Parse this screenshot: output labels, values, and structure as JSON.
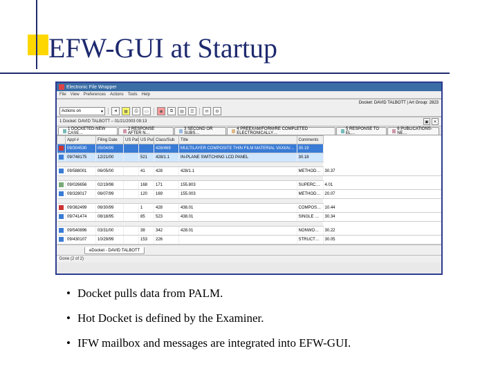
{
  "slide": {
    "title": "EFW-GUI at Startup"
  },
  "app": {
    "window_title": "Electronic File Wrapper",
    "menubar": [
      "File",
      "View",
      "Preferences",
      "Actions",
      "Tools",
      "Help"
    ],
    "status_right": "Docket: DAVID TALBOTT | Art Group: 2823",
    "toolbar": {
      "select_label": "Actions on"
    },
    "panel_title": "1 Docket: DAVID TALBOTT – 01/21/2003 09:13",
    "tabs": [
      "1 DOCKETED-NEW CASE…",
      "2 RESPONSE AFTER N…",
      "3 SECOND OR SUBS…",
      "4 PREEXAM/FORM/RE COMPLETED ELECTRONICALLY…",
      "5 RESPONSE TO EL…",
      "6 PUBLICATIONS-NE…"
    ],
    "columns": [
      "",
      "Appl #",
      "Filing Date",
      "US Pat",
      "US Pub",
      "Class/Sub",
      "Title",
      "Comments"
    ],
    "rows": [
      {
        "ico": "flag",
        "sel": true,
        "c": [
          "09/304530",
          "05/04/99",
          "",
          "",
          "428/469",
          "MULTILAYER COMPOSITE THIN FILM MATERIAL VAXI/A/AE/BIONEN…",
          "30.19"
        ]
      },
      {
        "ico": "person",
        "hl": true,
        "c": [
          "09/748175",
          "12/21/00",
          "",
          "521",
          "428/1.1",
          "IN-PLANE SWITCHING LCD PANEL",
          "30.18"
        ]
      },
      {
        "spacer": true
      },
      {
        "ico": "person",
        "c": [
          "09/588001",
          "06/05/00",
          "",
          "41",
          "428",
          "428/1.1",
          "METHOD OF CONTINUOUS PROGRAM CIRCUIT AND MANUFACTURING CO…",
          "30.37"
        ]
      },
      {
        "spacer": true
      },
      {
        "ico": "doc",
        "c": [
          "09/026656",
          "02/19/98",
          "",
          "168",
          "171",
          "155.803",
          "SUPERCONDUCTING WIRE AND MANUFACTURING METHOD FOR THE SAME",
          "4.01"
        ]
      },
      {
        "ico": "person",
        "c": [
          "09/328017",
          "06/07/99",
          "",
          "120",
          "169",
          "155.003",
          "METHODS OF MAKING COMPLIANT SEMICONDUCTOR CHIP PACKAGES",
          "20.07"
        ]
      },
      {
        "spacer": true
      },
      {
        "ico": "flag",
        "c": [
          "09/362499",
          "06/30/99",
          "",
          "1",
          "428",
          "438.01",
          "COMPOSITE LAMINATED PANEL HAVING A UNIVERSAL SUBSTRATE WITH VARIOUS M…",
          "10.44"
        ]
      },
      {
        "ico": "person",
        "c": [
          "09/741474",
          "08/18/95",
          "",
          "85",
          "523",
          "438.01",
          "SINGLE LAYER THIN FILM SUBSTRATE USED TO FORM MICROELECTRONICS DEV…",
          "30.34"
        ]
      },
      {
        "spacer": true
      },
      {
        "ico": "person",
        "c": [
          "09/540896",
          "03/31/00",
          "",
          "38",
          "342",
          "428.01",
          "NONWOVEN FABRIC OF FIBERS COMPOSED OF ALKALI SPECIES; METHOD FOR MANUF…",
          "30.22"
        ]
      },
      {
        "ico": "person",
        "c": [
          "09/430107",
          "10/29/99",
          "",
          "153",
          "226",
          "",
          "STRUCTURAL ALUMINUM BASE ALLOY USING F…",
          "30.05"
        ]
      }
    ],
    "bottom_tab": "eDocket - DAVID TALBOTT",
    "footer": "Done (2 of 2)"
  },
  "bullets": {
    "items": [
      "Docket pulls data from PALM.",
      "Hot Docket is defined by the Examiner.",
      "IFW mailbox and messages are integrated into EFW-GUI."
    ]
  }
}
